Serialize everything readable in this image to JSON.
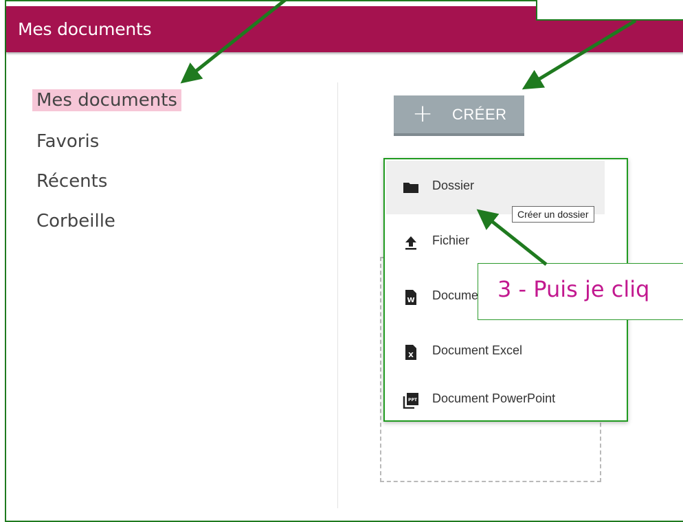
{
  "header": {
    "title": "Mes documents"
  },
  "sidebar": {
    "items": [
      {
        "label": "Mes documents",
        "active": true
      },
      {
        "label": "Favoris",
        "active": false
      },
      {
        "label": "Récents",
        "active": false
      },
      {
        "label": "Corbeille",
        "active": false
      }
    ]
  },
  "toolbar": {
    "create_icon": "plus-icon",
    "create_label": "CRÉER"
  },
  "create_menu": {
    "items": [
      {
        "label": "Dossier",
        "icon": "folder-icon",
        "hovered": true
      },
      {
        "label": "Fichier",
        "icon": "upload-icon",
        "hovered": false
      },
      {
        "label": "Document Word",
        "icon": "word-doc-icon",
        "hovered": false
      },
      {
        "label": "Document Excel",
        "icon": "excel-doc-icon",
        "hovered": false
      },
      {
        "label": "Document PowerPoint",
        "icon": "powerpoint-doc-icon",
        "hovered": false
      }
    ],
    "tooltip": "Créer un dossier"
  },
  "annotation": {
    "callout_text": "3 - Puis je cliq"
  },
  "colors": {
    "header_bg": "#a5124f",
    "active_nav_bg": "#f6c6d7",
    "create_button_bg": "#9ca8ae",
    "annotation_green": "#1f7a1f",
    "callout_text": "#c2188f"
  }
}
